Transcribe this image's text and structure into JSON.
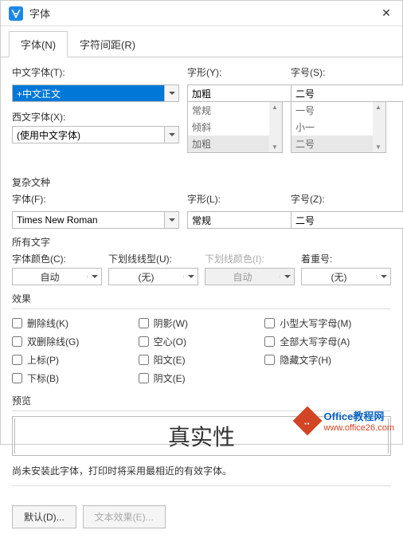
{
  "titlebar": {
    "title": "字体"
  },
  "tabs": {
    "font": "字体(N)",
    "spacing": "字符间距(R)"
  },
  "cn_font": {
    "label": "中文字体(T):",
    "value": "+中文正文"
  },
  "style": {
    "label": "字形(Y):",
    "value": "加粗",
    "options": [
      "常规",
      "倾斜",
      "加粗"
    ]
  },
  "size": {
    "label": "字号(S):",
    "value": "二号",
    "options": [
      "一号",
      "小一",
      "二号"
    ]
  },
  "west_font": {
    "label": "西文字体(X):",
    "value": "(使用中文字体)"
  },
  "complex": {
    "title": "复杂文种",
    "font": {
      "label": "字体(F):",
      "value": "Times New Roman"
    },
    "style": {
      "label": "字形(L):",
      "value": "常规"
    },
    "size": {
      "label": "字号(Z):",
      "value": "二号"
    }
  },
  "alltext": {
    "title": "所有文字",
    "color": {
      "label": "字体颜色(C):",
      "value": "自动"
    },
    "underline": {
      "label": "下划线线型(U):",
      "value": "(无)"
    },
    "underline_color": {
      "label": "下划线颜色(I):",
      "value": "自动"
    },
    "emphasis": {
      "label": "着重号:",
      "value": "(无)"
    }
  },
  "effects": {
    "title": "效果",
    "strike": "删除线(K)",
    "dblstrike": "双删除线(G)",
    "super": "上标(P)",
    "sub": "下标(B)",
    "shadow": "阴影(W)",
    "outline": "空心(O)",
    "emboss": "阳文(E)",
    "engrave": "阴文(E)",
    "smallcaps": "小型大写字母(M)",
    "allcaps": "全部大写字母(A)",
    "hidden": "隐藏文字(H)"
  },
  "preview": {
    "title": "预览",
    "text": "真实性"
  },
  "note": "尚未安装此字体，打印时将采用最相近的有效字体。",
  "footer": {
    "default": "默认(D)...",
    "texteffect": "文本效果(E)..."
  },
  "watermark": {
    "badge": "..",
    "line1": "Office教程网",
    "line2": "www.office26.com"
  }
}
